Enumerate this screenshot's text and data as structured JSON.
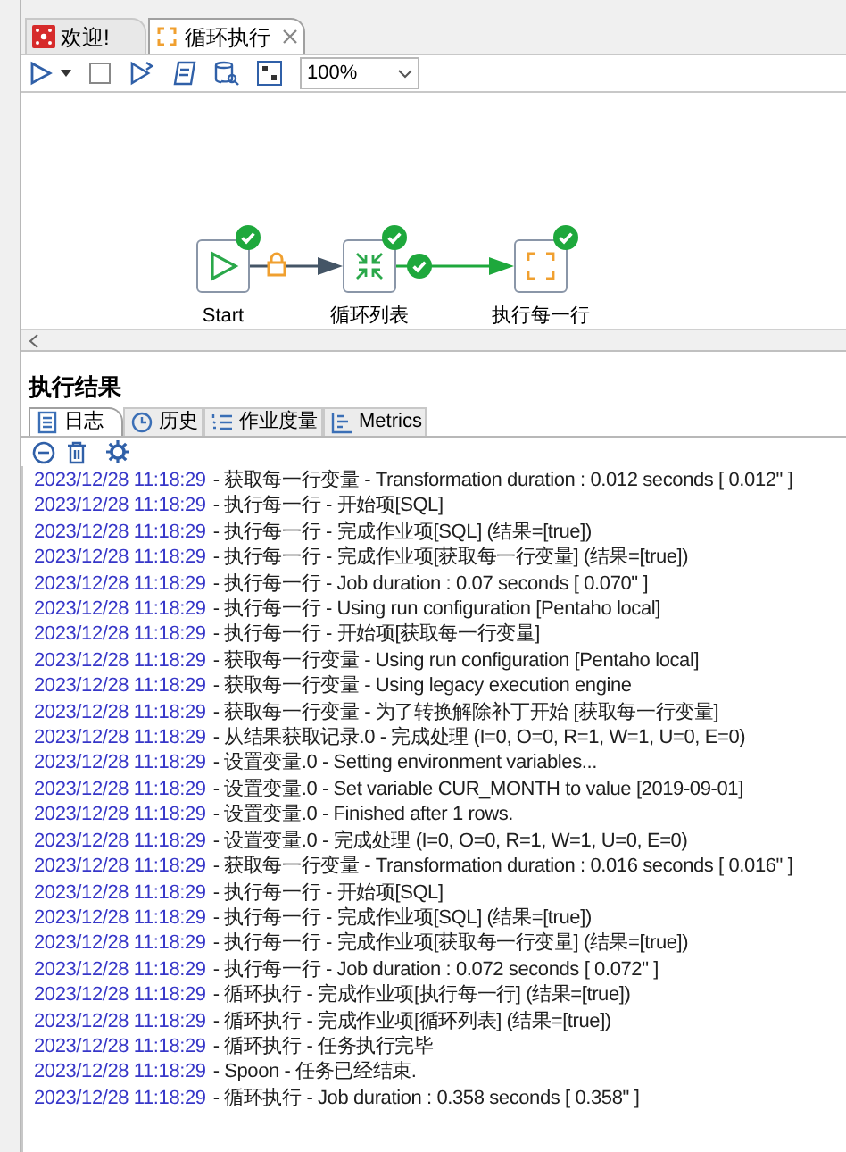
{
  "editor_tabs": [
    {
      "label": "欢迎!",
      "kind": "welcome",
      "selected": false,
      "closable": false
    },
    {
      "label": "循环执行",
      "kind": "job",
      "selected": true,
      "closable": true
    }
  ],
  "toolbar": {
    "zoom": "100%"
  },
  "canvas": {
    "nodes": [
      {
        "label": "Start",
        "kind": "start",
        "ok": true
      },
      {
        "label": "循环列表",
        "kind": "loop",
        "ok": true
      },
      {
        "label": "执行每一行",
        "kind": "job",
        "ok": true
      }
    ],
    "hops": [
      {
        "kind": "unconditional"
      },
      {
        "kind": "success"
      }
    ]
  },
  "results": {
    "title": "执行结果",
    "tabs": [
      {
        "label": "日志",
        "kind": "log",
        "selected": true
      },
      {
        "label": "历史",
        "kind": "history",
        "selected": false
      },
      {
        "label": "作业度量",
        "kind": "metrics-list",
        "selected": false
      },
      {
        "label": "Metrics",
        "kind": "chart",
        "selected": false
      }
    ],
    "log": [
      {
        "time": "2023/12/28 11:18:29",
        "message": "- 获取每一行变量 - Transformation duration : 0.012 seconds [  0.012\" ]"
      },
      {
        "time": "2023/12/28 11:18:29",
        "message": "- 执行每一行 - 开始项[SQL]"
      },
      {
        "time": "2023/12/28 11:18:29",
        "message": "- 执行每一行 - 完成作业项[SQL] (结果=[true])"
      },
      {
        "time": "2023/12/28 11:18:29",
        "message": "- 执行每一行 - 完成作业项[获取每一行变量] (结果=[true])"
      },
      {
        "time": "2023/12/28 11:18:29",
        "message": "- 执行每一行 - Job duration : 0.07 seconds [  0.070\" ]"
      },
      {
        "time": "2023/12/28 11:18:29",
        "message": "- 执行每一行 - Using run configuration [Pentaho local]"
      },
      {
        "time": "2023/12/28 11:18:29",
        "message": "- 执行每一行 - 开始项[获取每一行变量]"
      },
      {
        "time": "2023/12/28 11:18:29",
        "message": "- 获取每一行变量 - Using run configuration [Pentaho local]"
      },
      {
        "time": "2023/12/28 11:18:29",
        "message": "- 获取每一行变量 - Using legacy execution engine"
      },
      {
        "time": "2023/12/28 11:18:29",
        "message": "- 获取每一行变量 - 为了转换解除补丁开始  [获取每一行变量]"
      },
      {
        "time": "2023/12/28 11:18:29",
        "message": "- 从结果获取记录.0 - 完成处理 (I=0, O=0, R=1, W=1, U=0, E=0)"
      },
      {
        "time": "2023/12/28 11:18:29",
        "message": "- 设置变量.0 - Setting environment variables..."
      },
      {
        "time": "2023/12/28 11:18:29",
        "message": "- 设置变量.0 - Set variable CUR_MONTH to value [2019-09-01]"
      },
      {
        "time": "2023/12/28 11:18:29",
        "message": "- 设置变量.0 - Finished after 1 rows."
      },
      {
        "time": "2023/12/28 11:18:29",
        "message": "- 设置变量.0 - 完成处理 (I=0, O=0, R=1, W=1, U=0, E=0)"
      },
      {
        "time": "2023/12/28 11:18:29",
        "message": "- 获取每一行变量 - Transformation duration : 0.016 seconds [  0.016\" ]"
      },
      {
        "time": "2023/12/28 11:18:29",
        "message": "- 执行每一行 - 开始项[SQL]"
      },
      {
        "time": "2023/12/28 11:18:29",
        "message": "- 执行每一行 - 完成作业项[SQL] (结果=[true])"
      },
      {
        "time": "2023/12/28 11:18:29",
        "message": "- 执行每一行 - 完成作业项[获取每一行变量] (结果=[true])"
      },
      {
        "time": "2023/12/28 11:18:29",
        "message": "- 执行每一行 - Job duration : 0.072 seconds [  0.072\" ]"
      },
      {
        "time": "2023/12/28 11:18:29",
        "message": "- 循环执行 - 完成作业项[执行每一行] (结果=[true])"
      },
      {
        "time": "2023/12/28 11:18:29",
        "message": "- 循环执行 - 完成作业项[循环列表] (结果=[true])"
      },
      {
        "time": "2023/12/28 11:18:29",
        "message": "- 循环执行 - 任务执行完毕"
      },
      {
        "time": "2023/12/28 11:18:29",
        "message": "- Spoon - 任务已经结束."
      },
      {
        "time": "2023/12/28 11:18:29",
        "message": "- 循环执行 - Job duration : 0.358 seconds [  0.358\" ]"
      }
    ]
  }
}
